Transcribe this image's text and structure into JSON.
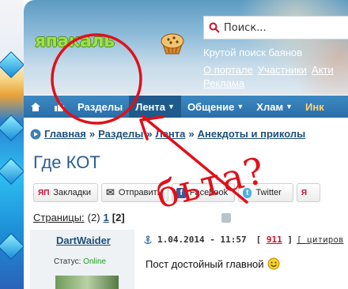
{
  "header": {
    "logo": "япакаль",
    "search": {
      "placeholder": "Поиск..."
    },
    "tagline": "Крутой поиск баянов",
    "links": [
      "О портале",
      "Участники",
      "Акти",
      "Реклама"
    ]
  },
  "nav": {
    "items": [
      {
        "label": "Разделы",
        "dropdown": false,
        "active": false
      },
      {
        "label": "Лента",
        "dropdown": true,
        "active": true
      },
      {
        "label": "Общение",
        "dropdown": true,
        "active": false
      },
      {
        "label": "Хлам",
        "dropdown": true,
        "active": false
      },
      {
        "label": "Инк",
        "dropdown": false,
        "active": false
      }
    ],
    "dropdown_arrow": "▼"
  },
  "breadcrumb": {
    "items": [
      "Главная",
      "Разделы",
      "Лента",
      "Анекдоты и приколы"
    ],
    "separator": "»"
  },
  "topic": {
    "title": "Где КОТ"
  },
  "share": {
    "buttons": [
      {
        "badge": "ЯП",
        "label": "Закладки",
        "icon": "yap-icon"
      },
      {
        "badge": "✉",
        "label": "Отправить",
        "icon": "mail-icon"
      },
      {
        "badge": "f",
        "label": "Facebook",
        "icon": "facebook-icon"
      },
      {
        "badge": "t",
        "label": "Twitter",
        "icon": "twitter-icon"
      },
      {
        "badge": "Я",
        "label": "",
        "icon": "yandex-icon"
      }
    ]
  },
  "pagination": {
    "label": "Страницы:",
    "count": "(2)",
    "pages": [
      "1"
    ],
    "current": "[2]"
  },
  "post": {
    "author": "DartWaider",
    "status_label": "Статус:",
    "status_value": "Online",
    "date": "1.04.2014 - 11:57",
    "rating_open": "[",
    "rating": "911",
    "rating_close": "]",
    "quote": "[ цитиров",
    "body": "Пост достойный главной"
  },
  "annotation": {
    "text": "бьта?",
    "color": "#e0101a"
  },
  "colors": {
    "nav_bg": "#2a6ea8",
    "link": "#1e4f7a",
    "title": "#2b5f8f",
    "online": "#1f9e25",
    "rating": "#c8102e",
    "logo": "#9ee14a"
  }
}
